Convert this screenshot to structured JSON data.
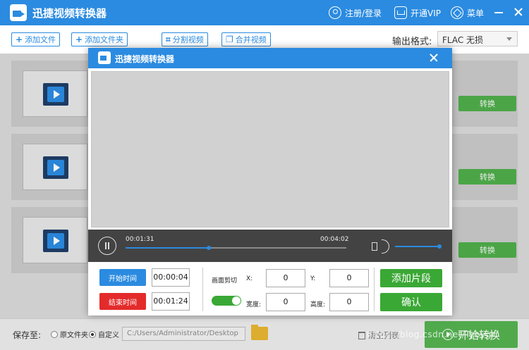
{
  "app": {
    "title": "迅捷视频转换器"
  },
  "titlebar": {
    "login": "注册/登录",
    "vip": "开通VIP",
    "menu": "菜单"
  },
  "toolbar": {
    "add_file": "添加文件",
    "add_folder": "添加文件夹",
    "split_video": "分割视频",
    "merge_video": "合并视频",
    "format_label": "输出格式:",
    "format_value": "FLAC  无损"
  },
  "list": {
    "items": [
      {
        "convert": "转换"
      },
      {
        "convert": "转换"
      },
      {
        "convert": "转换"
      }
    ]
  },
  "bottom": {
    "save_to": "保存至:",
    "option_original": "原文件夹",
    "option_custom": "自定义",
    "selected_option": "自定义",
    "path": "C:/Users/Administrator/Desktop",
    "clear_list": "清空列表",
    "start": "开始转换"
  },
  "watermark": "https://blog.csdn.net/Tybygr",
  "dialog": {
    "title": "迅捷视频转换器",
    "player": {
      "current_time": "00:01:31",
      "total_time": "00:04:02",
      "progress": 0.376,
      "volume": 1.0
    },
    "cut": {
      "start_label": "开始时间",
      "start_value": "00:00:04",
      "end_label": "结束时间",
      "end_value": "00:01:24",
      "crop_label": "画面剪切",
      "crop_enabled": true,
      "x_label": "X:",
      "x_value": "0",
      "y_label": "Y:",
      "y_value": "0",
      "width_label": "宽度:",
      "width_value": "0",
      "height_label": "高度:",
      "height_value": "0",
      "add_segment": "添加片段",
      "confirm": "确认"
    }
  },
  "colors": {
    "accent": "#2b8be0",
    "green": "#3aa835",
    "red": "#e42b2b",
    "player_bg": "#434343"
  }
}
